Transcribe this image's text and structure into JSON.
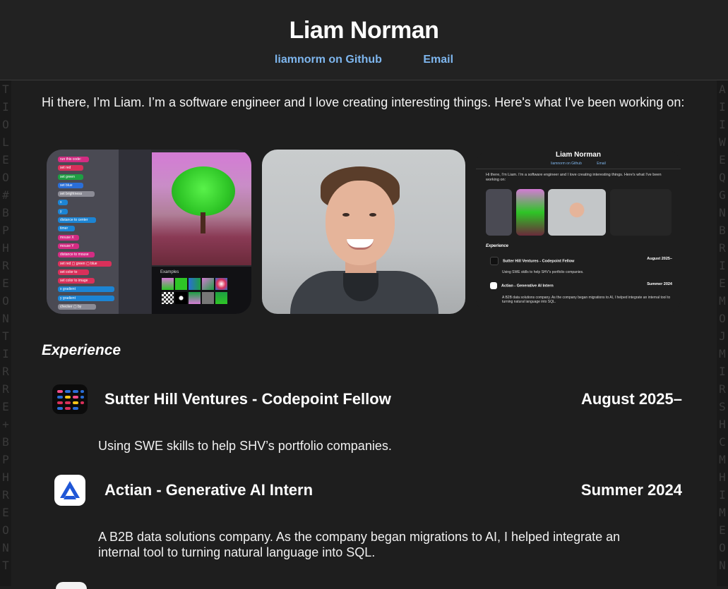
{
  "header": {
    "name": "Liam Norman",
    "github_link": "liamnorm on Github",
    "email_link": "Email"
  },
  "intro": "Hi there, I’m Liam. I’m a software engineer and I love creating interesting things. Here's what I've been working on:",
  "gallery": {
    "editor_blocks": [
      "run this code:",
      "set red",
      "set green",
      "set blue",
      "set brightness",
      "x",
      "y",
      "distance to center",
      "timer",
      "mouse X",
      "mouse Y",
      "distance to mouse",
      "set red ▢ green ▢ blue",
      "set color to",
      "set color to image",
      "x gradient",
      "y gradient",
      "checker ▢ by"
    ],
    "examples_label": "Examples",
    "mini_site": {
      "title": "Liam Norman",
      "github": "liamnorm on Github",
      "email": "Email",
      "intro": "Hi there, I’m Liam. I’m a software engineer and I love creating interesting things. Here's what I've been working on:",
      "experience": "Experience",
      "job1": "Sutter Hill Ventures - Codepoint Fellow",
      "job1_date": "August 2025–",
      "job1_desc": "Using SWE skills to help SHV’s portfolio companies.",
      "job2": "Actian - Generative AI Intern",
      "job2_date": "Summer 2024",
      "job2_desc": "A B2B data solutions company. As the company began migrations to AI, I helped integrate an internal tool to turning natural language into SQL."
    }
  },
  "experience_heading": "Experience",
  "jobs": [
    {
      "title": "Sutter Hill Ventures - Codepoint Fellow",
      "date": "August 2025–",
      "description": "Using SWE skills to help SHV’s portfolio companies.",
      "icon": "sutter-hill-logo"
    },
    {
      "title": "Actian - Generative AI Intern",
      "date": "Summer 2024",
      "description": "A B2B data solutions company. As the company began migrations to AI, I helped integrate an internal tool to turning natural language into SQL.",
      "icon": "actian-logo"
    }
  ],
  "side_strip_left": [
    "T",
    "I",
    "O",
    "L",
    "E",
    "O",
    "#",
    "B",
    "P",
    "H",
    "R",
    "E",
    "O",
    "N",
    "T",
    "I",
    "R",
    "R",
    "E",
    "+",
    "B",
    "P",
    "H",
    "R",
    "E",
    "O",
    "N",
    "T"
  ],
  "side_strip_right": [
    "A",
    "I",
    "I",
    "W",
    "E",
    "Q",
    "G",
    "N",
    "B",
    "R",
    "I",
    "E",
    "M",
    "O",
    "J",
    "M",
    "I",
    "R",
    "S",
    "H",
    "C",
    "M",
    "H",
    "I",
    "M",
    "E",
    "O",
    "N"
  ],
  "colors": {
    "background": "#1e1e1e",
    "header_bg": "#222222",
    "link": "#7eb6ee",
    "text": "#f2f2f2"
  }
}
